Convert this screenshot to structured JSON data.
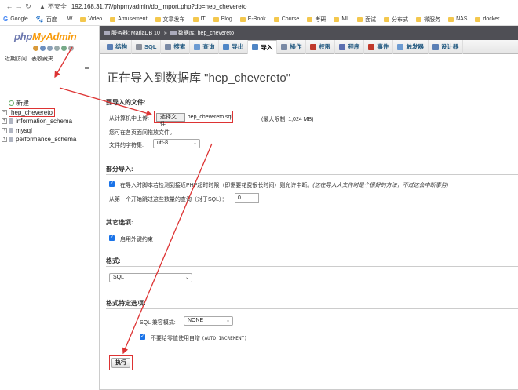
{
  "browser": {
    "insecure_label": "不安全",
    "url": "192.168.31.77/phpmyadmin/db_import.php?db=hep_chevereto",
    "bookmarks": [
      {
        "label": "Google",
        "icon": "google-icon"
      },
      {
        "label": "百度",
        "icon": "baidu-icon"
      },
      {
        "label": "W",
        "icon": "wiki-icon"
      },
      {
        "label": "Video",
        "icon": "folder-icon"
      },
      {
        "label": "Amusement",
        "icon": "folder-icon"
      },
      {
        "label": "文章发布",
        "icon": "folder-icon"
      },
      {
        "label": "IT",
        "icon": "folder-icon"
      },
      {
        "label": "Blog",
        "icon": "folder-icon"
      },
      {
        "label": "E-Book",
        "icon": "folder-icon"
      },
      {
        "label": "Course",
        "icon": "folder-icon"
      },
      {
        "label": "考研",
        "icon": "folder-icon"
      },
      {
        "label": "ML",
        "icon": "folder-icon"
      },
      {
        "label": "面试",
        "icon": "folder-icon"
      },
      {
        "label": "分布式",
        "icon": "folder-icon"
      },
      {
        "label": "微服务",
        "icon": "folder-icon"
      },
      {
        "label": "NAS",
        "icon": "folder-icon"
      },
      {
        "label": "docker",
        "icon": "folder-icon"
      }
    ]
  },
  "sidebar": {
    "logo_php": "php",
    "logo_admin": "MyAdmin",
    "recent": "近期访问",
    "favorites": "表收藏夹",
    "new_label": "新建",
    "databases": [
      "hep_chevereto",
      "information_schema",
      "mysql",
      "performance_schema"
    ]
  },
  "topbar": {
    "server": "服务器: MariaDB 10",
    "database": "数据库: hep_chevereto"
  },
  "tabs": [
    {
      "label": "结构",
      "color": "#5a7fb5"
    },
    {
      "label": "SQL",
      "color": "#8a8f99"
    },
    {
      "label": "搜索",
      "color": "#7a8aa5"
    },
    {
      "label": "查询",
      "color": "#6c9bd2"
    },
    {
      "label": "导出",
      "color": "#4f86c6"
    },
    {
      "label": "导入",
      "color": "#4f86c6",
      "active": true
    },
    {
      "label": "操作",
      "color": "#7a8aa5"
    },
    {
      "label": "权限",
      "color": "#c0392b"
    },
    {
      "label": "程序",
      "color": "#5b6fb0"
    },
    {
      "label": "事件",
      "color": "#c0392b"
    },
    {
      "label": "触发器",
      "color": "#6c9bd2"
    },
    {
      "label": "设计器",
      "color": "#5a7fb5"
    }
  ],
  "main": {
    "title": "正在导入到数据库 \"hep_chevereto\"",
    "file_section": {
      "heading": "要导入的文件:",
      "upload_label": "从计算机中上传:",
      "browse_button": "选择文件",
      "file_name": "hep_chevereto.sql",
      "max_size": "(最大限制: 1,024 MB)",
      "compression_note": "您可在各页面间拖放文件。",
      "charset_label": "文件的字符集:",
      "charset_value": "utf-8"
    },
    "partial_section": {
      "heading": "部分导入:",
      "interrupt_label": "在导入时脚本若检测到接近PHP超时时限（即需要花费很长时间）则允许中断。",
      "interrupt_note": "(这在导入大文件时是个很好的方法，不过这会中断事务)",
      "skip_label": "从第一个开始跳过这些数量的查询（对于SQL）：",
      "skip_value": "0"
    },
    "other_section": {
      "heading": "其它选项:",
      "fk_label": "启用外键约束"
    },
    "format_section": {
      "heading": "格式:",
      "format_value": "SQL"
    },
    "format_options": {
      "heading": "格式特定选项:",
      "compat_label": "SQL 兼容模式:",
      "compat_value": "NONE",
      "autoinc_label": "不要给零值使用自增",
      "autoinc_code": "(AUTO_INCREMENT)"
    },
    "go_button": "执行"
  },
  "colors": {
    "annotation": "#dd3333",
    "topbar_bg": "#4f4f55",
    "checkbox": "#1a73e8"
  }
}
